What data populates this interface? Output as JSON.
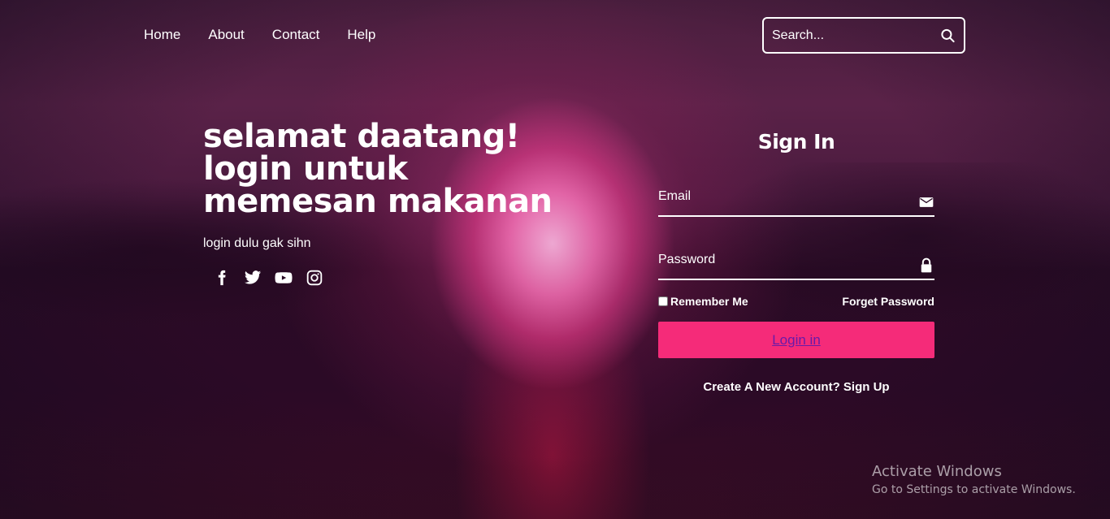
{
  "nav": {
    "items": [
      {
        "label": "Home"
      },
      {
        "label": "About"
      },
      {
        "label": "Contact"
      },
      {
        "label": "Help"
      }
    ]
  },
  "search": {
    "placeholder": "Search..."
  },
  "hero": {
    "title_lines": [
      "selamat daatang!",
      "login untuk",
      "memesan makanan"
    ],
    "subtitle": "login dulu gak sihn",
    "socials": [
      "facebook-icon",
      "twitter-icon",
      "youtube-icon",
      "instagram-icon"
    ]
  },
  "signin": {
    "title": "Sign In",
    "email_placeholder": "Email",
    "password_placeholder": "Password",
    "remember_label": "Remember Me",
    "forget_label": "Forget Password",
    "login_label": "Login in",
    "signup_text": "Create A New Account? Sign Up"
  },
  "watermark": {
    "title": "Activate Windows",
    "subtitle": "Go to Settings to activate Windows."
  },
  "colors": {
    "accent": "#f52b79",
    "link": "#6a1aa8"
  }
}
